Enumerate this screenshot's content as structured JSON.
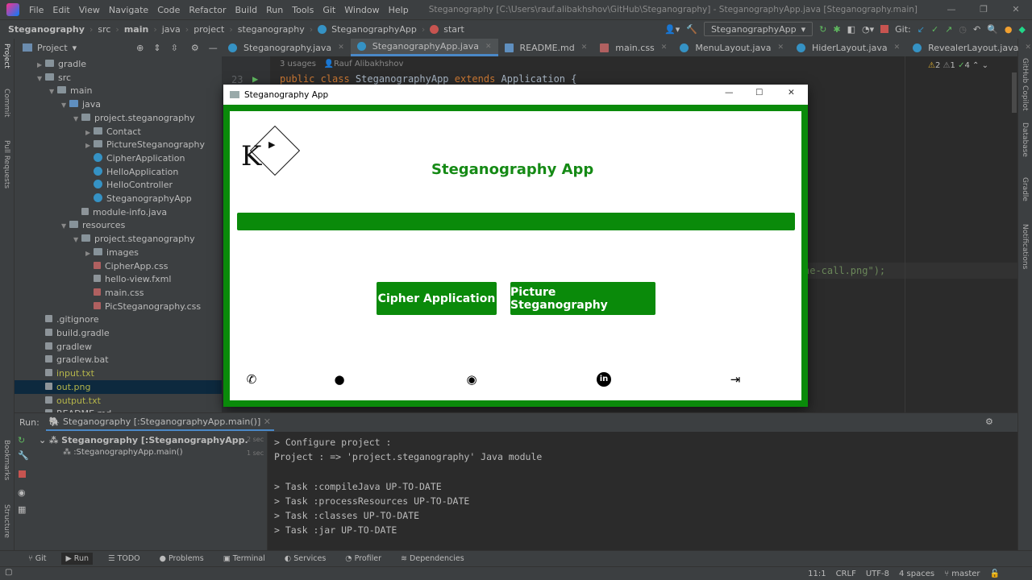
{
  "menu": {
    "items": [
      "File",
      "Edit",
      "View",
      "Navigate",
      "Code",
      "Refactor",
      "Build",
      "Run",
      "Tools",
      "Git",
      "Window",
      "Help"
    ],
    "title": "Steganography [C:\\Users\\rauf.alibakhshov\\GitHub\\Steganography] - SteganographyApp.java [Steganography.main]"
  },
  "breadcrumb": [
    "Steganography",
    "src",
    "main",
    "java",
    "project",
    "steganography",
    "SteganographyApp",
    "start"
  ],
  "toolbar": {
    "run_config": "SteganographyApp",
    "git_label": "Git:"
  },
  "project": {
    "header": "Project",
    "tree": [
      {
        "label": "gradle",
        "depth": 2,
        "type": "folder",
        "expanded": false
      },
      {
        "label": "src",
        "depth": 2,
        "type": "folder",
        "expanded": true
      },
      {
        "label": "main",
        "depth": 3,
        "type": "folder",
        "expanded": true
      },
      {
        "label": "java",
        "depth": 4,
        "type": "src",
        "expanded": true
      },
      {
        "label": "project.steganography",
        "depth": 5,
        "type": "folder",
        "expanded": true
      },
      {
        "label": "Contact",
        "depth": 6,
        "type": "folder",
        "expanded": false
      },
      {
        "label": "PictureSteganography",
        "depth": 6,
        "type": "folder",
        "expanded": false
      },
      {
        "label": "CipherApplication",
        "depth": 6,
        "type": "class"
      },
      {
        "label": "HelloApplication",
        "depth": 6,
        "type": "class"
      },
      {
        "label": "HelloController",
        "depth": 6,
        "type": "class"
      },
      {
        "label": "SteganographyApp",
        "depth": 6,
        "type": "class"
      },
      {
        "label": "module-info.java",
        "depth": 5,
        "type": "file"
      },
      {
        "label": "resources",
        "depth": 4,
        "type": "folder",
        "expanded": true
      },
      {
        "label": "project.steganography",
        "depth": 5,
        "type": "folder",
        "expanded": true
      },
      {
        "label": "images",
        "depth": 6,
        "type": "folder",
        "expanded": false
      },
      {
        "label": "CipherApp.css",
        "depth": 6,
        "type": "css"
      },
      {
        "label": "hello-view.fxml",
        "depth": 6,
        "type": "file"
      },
      {
        "label": "main.css",
        "depth": 6,
        "type": "css"
      },
      {
        "label": "PicSteganography.css",
        "depth": 6,
        "type": "css"
      },
      {
        "label": ".gitignore",
        "depth": 2,
        "type": "file"
      },
      {
        "label": "build.gradle",
        "depth": 2,
        "type": "file"
      },
      {
        "label": "gradlew",
        "depth": 2,
        "type": "file"
      },
      {
        "label": "gradlew.bat",
        "depth": 2,
        "type": "file"
      },
      {
        "label": "input.txt",
        "depth": 2,
        "type": "file",
        "color": "#b5b54a"
      },
      {
        "label": "out.png",
        "depth": 2,
        "type": "file",
        "color": "#b5b54a",
        "selected": true
      },
      {
        "label": "output.txt",
        "depth": 2,
        "type": "file",
        "color": "#b5b54a"
      },
      {
        "label": "README.md",
        "depth": 2,
        "type": "file"
      }
    ]
  },
  "tabs": [
    {
      "label": "Steganography.java"
    },
    {
      "label": "SteganographyApp.java",
      "active": true
    },
    {
      "label": "README.md"
    },
    {
      "label": "main.css"
    },
    {
      "label": "MenuLayout.java"
    },
    {
      "label": "HiderLayout.java"
    },
    {
      "label": "RevealerLayout.java"
    }
  ],
  "editor": {
    "usages": "3 usages",
    "author": "Rauf Alibakhshov",
    "line_no": "23",
    "code_kw1": "public class",
    "code_name": " SteganographyApp ",
    "code_kw2": "extends",
    "code_rest": " Application {",
    "code_frag": "ne-call.png\");",
    "inspections": {
      "warnings": "2",
      "weak": "1",
      "ok": "4"
    }
  },
  "side_right": [
    "GitHub Copilot",
    "Database",
    "Gradle",
    "Notifications"
  ],
  "side_left": [
    "Project",
    "Commit",
    "Pull Requests",
    "Bookmarks",
    "Structure"
  ],
  "run": {
    "label": "Run:",
    "tab": "Steganography [:SteganographyApp.main()]",
    "tree": [
      {
        "label": "Steganography [:SteganographyApp.main()]: Ru",
        "time": "2 sec"
      },
      {
        "label": ":SteganographyApp.main()",
        "time": "1 sec"
      }
    ],
    "console": [
      "> Configure project :",
      "Project : => 'project.steganography' Java module",
      "",
      "> Task :compileJava UP-TO-DATE",
      "> Task :processResources UP-TO-DATE",
      "> Task :classes UP-TO-DATE",
      "> Task :jar UP-TO-DATE"
    ]
  },
  "bottom_tabs": [
    "Git",
    "Run",
    "TODO",
    "Problems",
    "Terminal",
    "Services",
    "Profiler",
    "Dependencies"
  ],
  "status": {
    "position": "11:1",
    "line_sep": "CRLF",
    "encoding": "UTF-8",
    "indent": "4 spaces",
    "branch": "master"
  },
  "app": {
    "window_title": "Steganography App",
    "heading": "Steganography App",
    "logo_letter": "K",
    "buttons": [
      "Cipher Application",
      "Picture Steganography"
    ],
    "social_icons": [
      "phone-icon",
      "whatsapp-icon",
      "github-icon",
      "linkedin-icon",
      "exit-icon"
    ],
    "accent": "#0a8a0a"
  }
}
